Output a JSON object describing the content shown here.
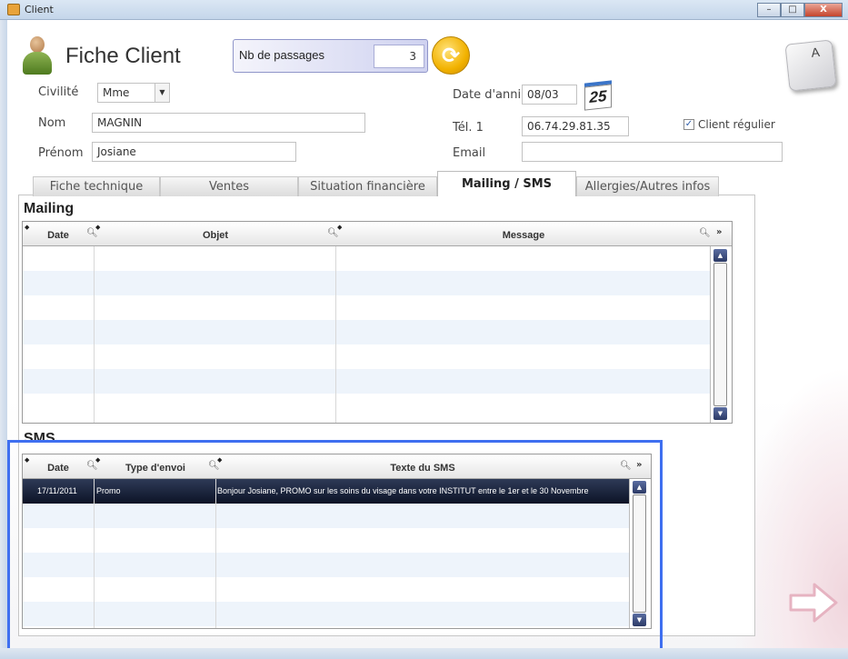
{
  "window": {
    "title": "Client",
    "minimize": "–",
    "maximize": "□",
    "close": "X"
  },
  "header": {
    "title": "Fiche Client",
    "passages_label": "Nb de passages",
    "passages_value": "3",
    "keycap_label": "A"
  },
  "form": {
    "civilite_label": "Civilité",
    "civilite_value": "Mme",
    "nom_label": "Nom",
    "nom_value": "MAGNIN",
    "prenom_label": "Prénom",
    "prenom_value": "Josiane",
    "date_anni_label": "Date d'anni",
    "date_anni_value": "08/03",
    "calendar_day": "25",
    "tel_label": "Tél. 1",
    "tel_value": "06.74.29.81.35",
    "email_label": "Email",
    "email_value": "",
    "client_regulier_label": "Client régulier",
    "client_regulier_checked": true
  },
  "tabs": [
    {
      "label": "Fiche technique"
    },
    {
      "label": "Ventes"
    },
    {
      "label": "Situation financière"
    },
    {
      "label": "Mailing / SMS"
    },
    {
      "label": "Allergies/Autres infos"
    }
  ],
  "active_tab": "Mailing / SMS",
  "mailing": {
    "title": "Mailing",
    "columns": [
      "Date",
      "Objet",
      "Message"
    ],
    "rows": []
  },
  "sms": {
    "title": "SMS",
    "columns": [
      "Date",
      "Type d'envoi",
      "Texte du SMS"
    ],
    "rows": [
      {
        "date": "17/11/2011",
        "type": "Promo",
        "texte": "Bonjour Josiane, PROMO sur les soins du visage dans votre INSTITUT entre le 1er et le 30 Novembre"
      }
    ]
  },
  "colors": {
    "highlight": "#3f6ff0",
    "selected_row": "#0c1326",
    "alt_row": "#eef4fb",
    "accent_refresh": "#f2b200"
  }
}
